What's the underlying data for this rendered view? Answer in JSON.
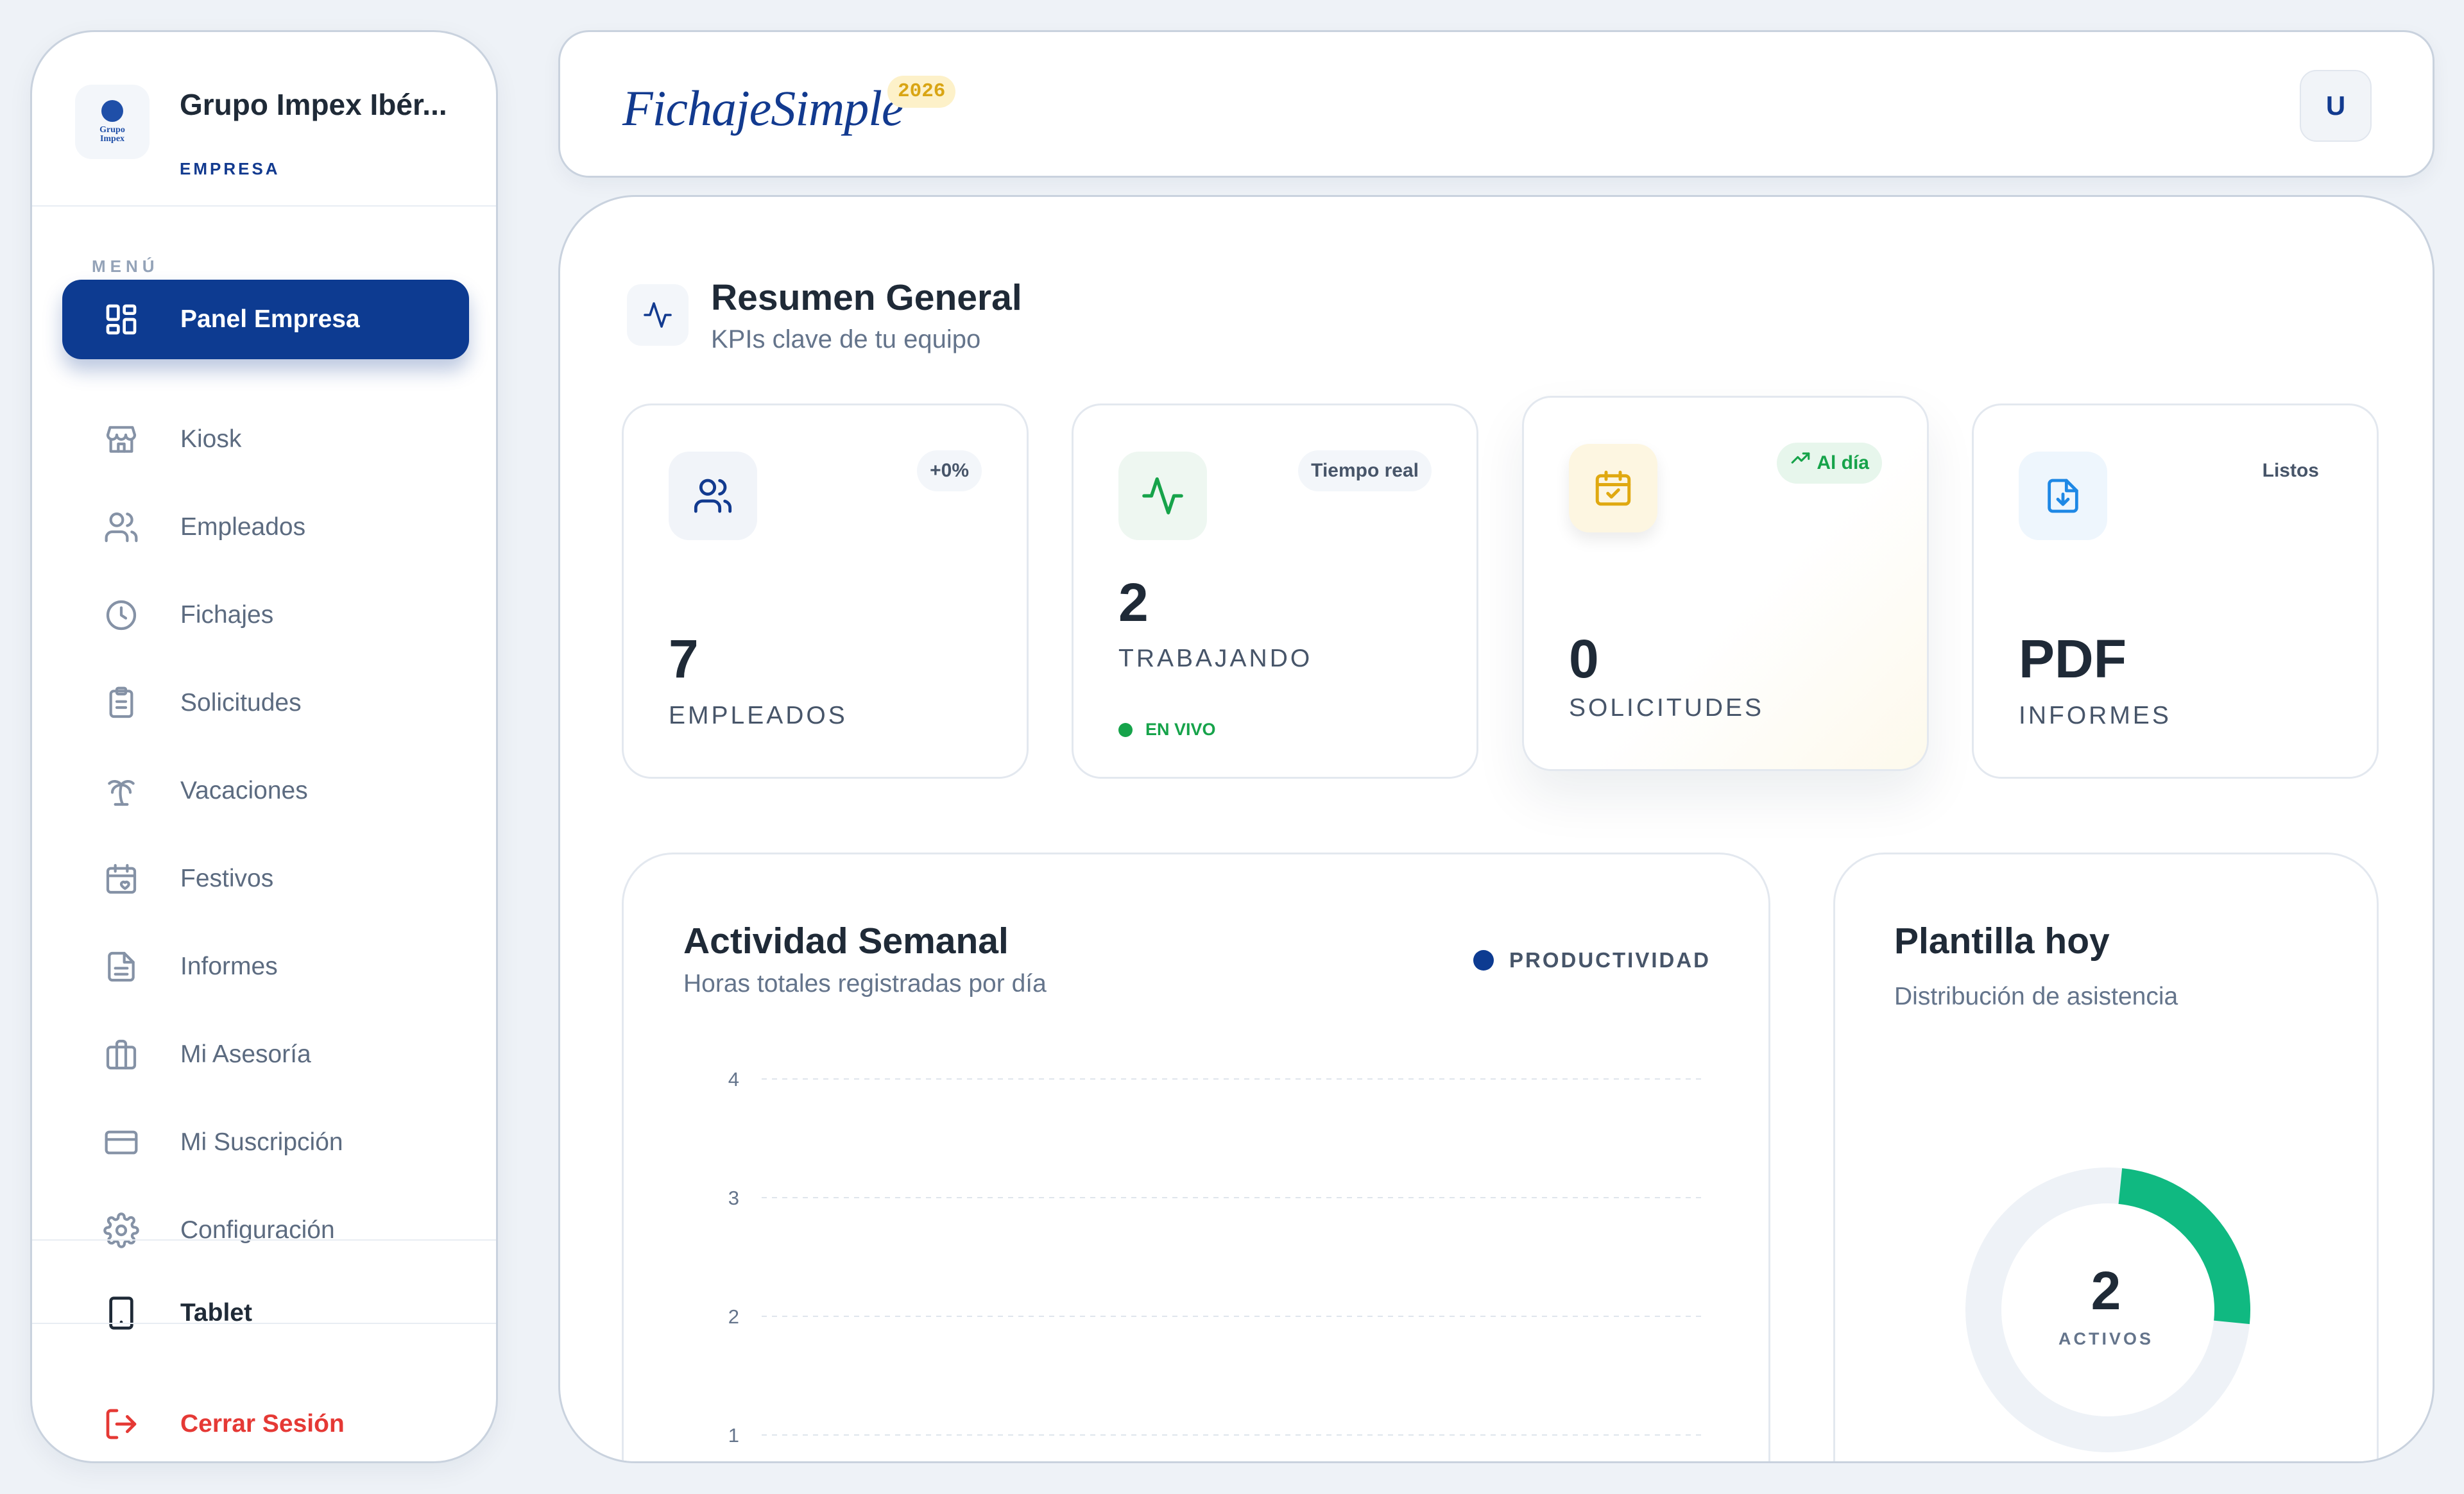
{
  "company": {
    "name": "Grupo Impex Ibér...",
    "role": "EMPRESA",
    "logo_text_line1": "Grupo",
    "logo_text_line2": "Impex"
  },
  "menu": {
    "heading": "MENÚ",
    "items": [
      {
        "label": "Panel Empresa",
        "icon": "dashboard-icon",
        "active": true
      },
      {
        "label": "Kiosk",
        "icon": "store-icon"
      },
      {
        "label": "Empleados",
        "icon": "users-icon"
      },
      {
        "label": "Fichajes",
        "icon": "clock-icon"
      },
      {
        "label": "Solicitudes",
        "icon": "clipboard-icon"
      },
      {
        "label": "Vacaciones",
        "icon": "palm-tree-icon"
      },
      {
        "label": "Festivos",
        "icon": "calendar-heart-icon"
      },
      {
        "label": "Informes",
        "icon": "file-text-icon"
      },
      {
        "label": "Mi Asesoría",
        "icon": "briefcase-icon"
      },
      {
        "label": "Mi Suscripción",
        "icon": "credit-card-icon"
      },
      {
        "label": "Configuración",
        "icon": "gear-icon"
      }
    ],
    "tablet": "Tablet",
    "logout": "Cerrar Sesión"
  },
  "header": {
    "logo": "FichajeSimple",
    "year": "2026",
    "avatar": "U"
  },
  "summary": {
    "title": "Resumen General",
    "subtitle": "KPIs clave de tu equipo"
  },
  "kpis": [
    {
      "badge": "+0%",
      "value": "7",
      "label": "EMPLEADOS",
      "icon": "users-icon",
      "color": "#123a8f"
    },
    {
      "badge": "Tiempo real",
      "value": "2",
      "label": "TRABAJANDO",
      "live": "EN VIVO",
      "icon": "activity-icon",
      "color": "#16a34a"
    },
    {
      "badge": "Al día",
      "value": "0",
      "label": "SOLICITUDES",
      "icon": "calendar-check-icon",
      "color": "#e0a910"
    },
    {
      "badge": "Listos",
      "value": "PDF",
      "label": "INFORMES",
      "icon": "file-download-icon",
      "color": "#1e88e5"
    }
  ],
  "weekly": {
    "title": "Actividad Semanal",
    "subtitle": "Horas totales registradas por día",
    "legend": "PRODUCTIVIDAD"
  },
  "chart_data": {
    "type": "bar",
    "title": "Actividad Semanal",
    "ylabel": "",
    "yticks": [
      4,
      3,
      2,
      1
    ],
    "ylim": [
      0,
      4
    ],
    "grid": true,
    "legend": "top-right",
    "series": [
      {
        "name": "PRODUCTIVIDAD",
        "values": []
      }
    ],
    "color": "#0d3b91"
  },
  "attendance": {
    "title": "Plantilla hoy",
    "subtitle": "Distribución de asistencia",
    "count": "2",
    "count_label": "ACTIVOS",
    "active_fraction": 0.25,
    "color": "#10b981"
  }
}
